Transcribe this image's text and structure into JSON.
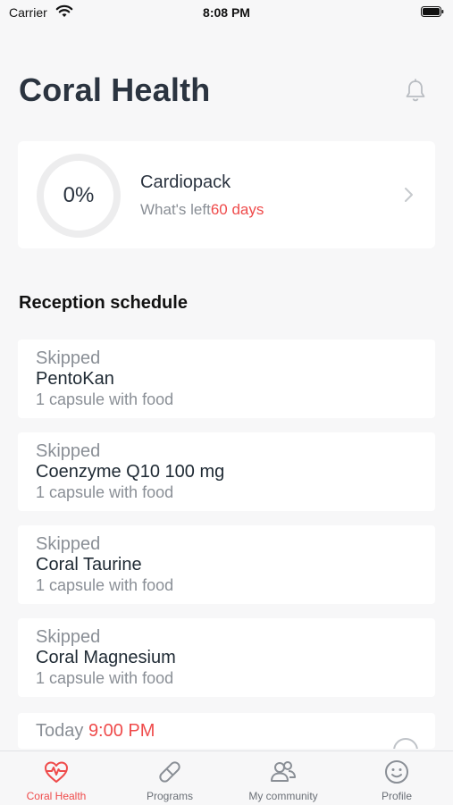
{
  "status_bar": {
    "carrier": "Carrier",
    "time": "8:08 PM"
  },
  "header": {
    "title": "Coral Health"
  },
  "pack": {
    "progress_label": "0%",
    "progress": 0,
    "name": "Cardiopack",
    "left_label": "What's left",
    "left_value": "60 days"
  },
  "schedule": {
    "title": "Reception schedule",
    "items": [
      {
        "status": "Skipped",
        "name": "PentoKan",
        "dose": "1 capsule with food"
      },
      {
        "status": "Skipped",
        "name": "Coenzyme Q10 100 mg",
        "dose": "1 capsule with food"
      },
      {
        "status": "Skipped",
        "name": "Coral Taurine",
        "dose": "1 capsule with food"
      },
      {
        "status": "Skipped",
        "name": "Coral Magnesium",
        "dose": "1 capsule with food"
      }
    ],
    "next": {
      "label": "Today",
      "time": "9:00 PM"
    }
  },
  "tabs": [
    {
      "label": "Coral Health",
      "icon": "heart-pulse-icon",
      "active": true
    },
    {
      "label": "Programs",
      "icon": "pill-icon",
      "active": false
    },
    {
      "label": "My community",
      "icon": "people-icon",
      "active": false
    },
    {
      "label": "Profile",
      "icon": "smiley-icon",
      "active": false
    }
  ],
  "colors": {
    "accent": "#ef4b4b",
    "muted": "#8a8f96",
    "text": "#1e2933",
    "background": "#f7f7f8"
  }
}
